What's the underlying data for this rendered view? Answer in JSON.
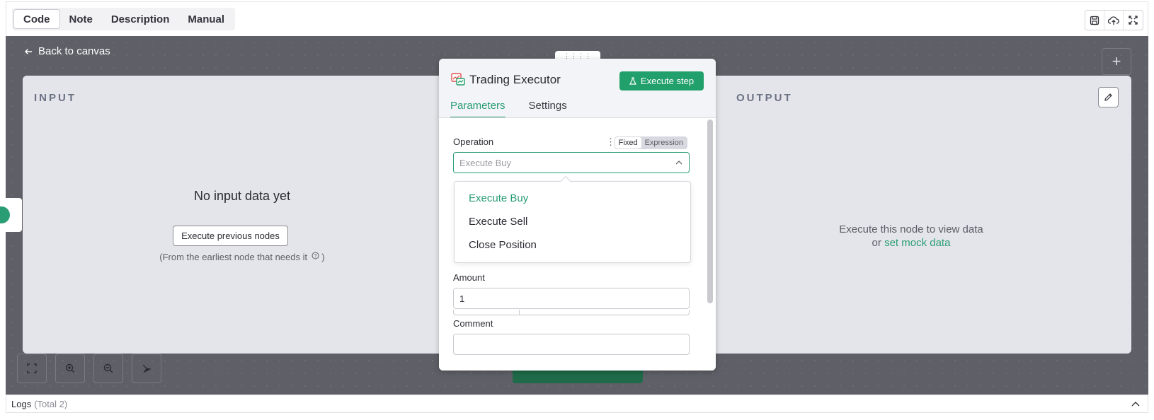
{
  "topbar": {
    "tabs": [
      "Code",
      "Note",
      "Description",
      "Manual"
    ],
    "active_tab": "Code",
    "icons": [
      "save-icon",
      "cloud-upload-icon",
      "fullscreen-icon"
    ]
  },
  "canvas": {
    "back_label": "Back to canvas"
  },
  "input_panel": {
    "label": "INPUT",
    "empty_title": "No input data yet",
    "execute_previous_label": "Execute previous nodes",
    "hint": "(From the earliest node that needs it",
    "hint_end": ")"
  },
  "output_panel": {
    "label": "OUTPUT",
    "message_line1": "Execute this node to view data",
    "message_or": "or",
    "mock_link": "set mock data"
  },
  "node": {
    "title": "Trading Executor",
    "execute_step_label": "Execute step",
    "tabs": [
      "Parameters",
      "Settings"
    ],
    "active_tab": "Parameters"
  },
  "params": {
    "operation_label": "Operation",
    "fixed_label": "Fixed",
    "expression_label": "Expression",
    "operation_placeholder": "Execute Buy",
    "amount_label": "Amount",
    "amount_value": "1",
    "comment_label": "Comment",
    "comment_value": ""
  },
  "dropdown": {
    "options": [
      "Execute Buy",
      "Execute Sell",
      "Close Position"
    ],
    "selected": "Execute Buy"
  },
  "logs": {
    "label": "Logs",
    "count": "(Total 2)"
  },
  "colors": {
    "accent": "#2a9d74",
    "execute_button": "#22a06b",
    "canvas": "#5f5f67"
  }
}
